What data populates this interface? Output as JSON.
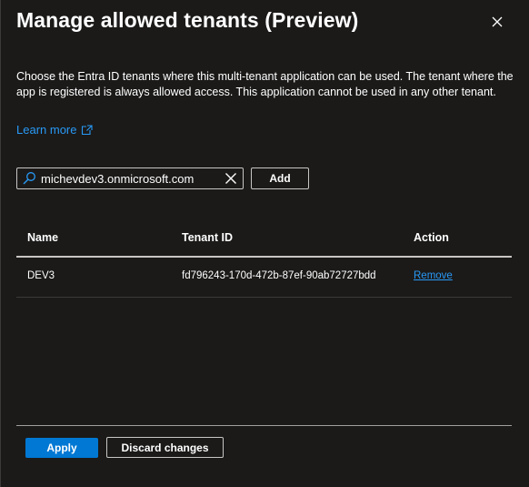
{
  "dialog": {
    "title": "Manage allowed tenants (Preview)",
    "close_icon": "close-icon",
    "description": "Choose the Entra ID tenants where this multi-tenant application can be used. The tenant where the app is registered is always allowed access. This application cannot be used in any other tenant.",
    "learn_more": "Learn more",
    "learn_more_icon": "external-link-icon"
  },
  "search": {
    "icon": "search-icon",
    "value": "michevdev3.onmicrosoft.com",
    "clear_icon": "clear-icon",
    "add_label": "Add"
  },
  "table": {
    "columns": [
      "Name",
      "Tenant ID",
      "Action"
    ],
    "rows": [
      {
        "name": "DEV3",
        "tenant_id": "fd796243-170d-472b-87ef-90ab72727bdd",
        "action": "Remove"
      }
    ]
  },
  "footer": {
    "apply_label": "Apply",
    "discard_label": "Discard changes"
  },
  "colors": {
    "background": "#1b1a19",
    "link": "#2899f5",
    "primary": "#0078d4",
    "border": "#c8c6c4"
  }
}
